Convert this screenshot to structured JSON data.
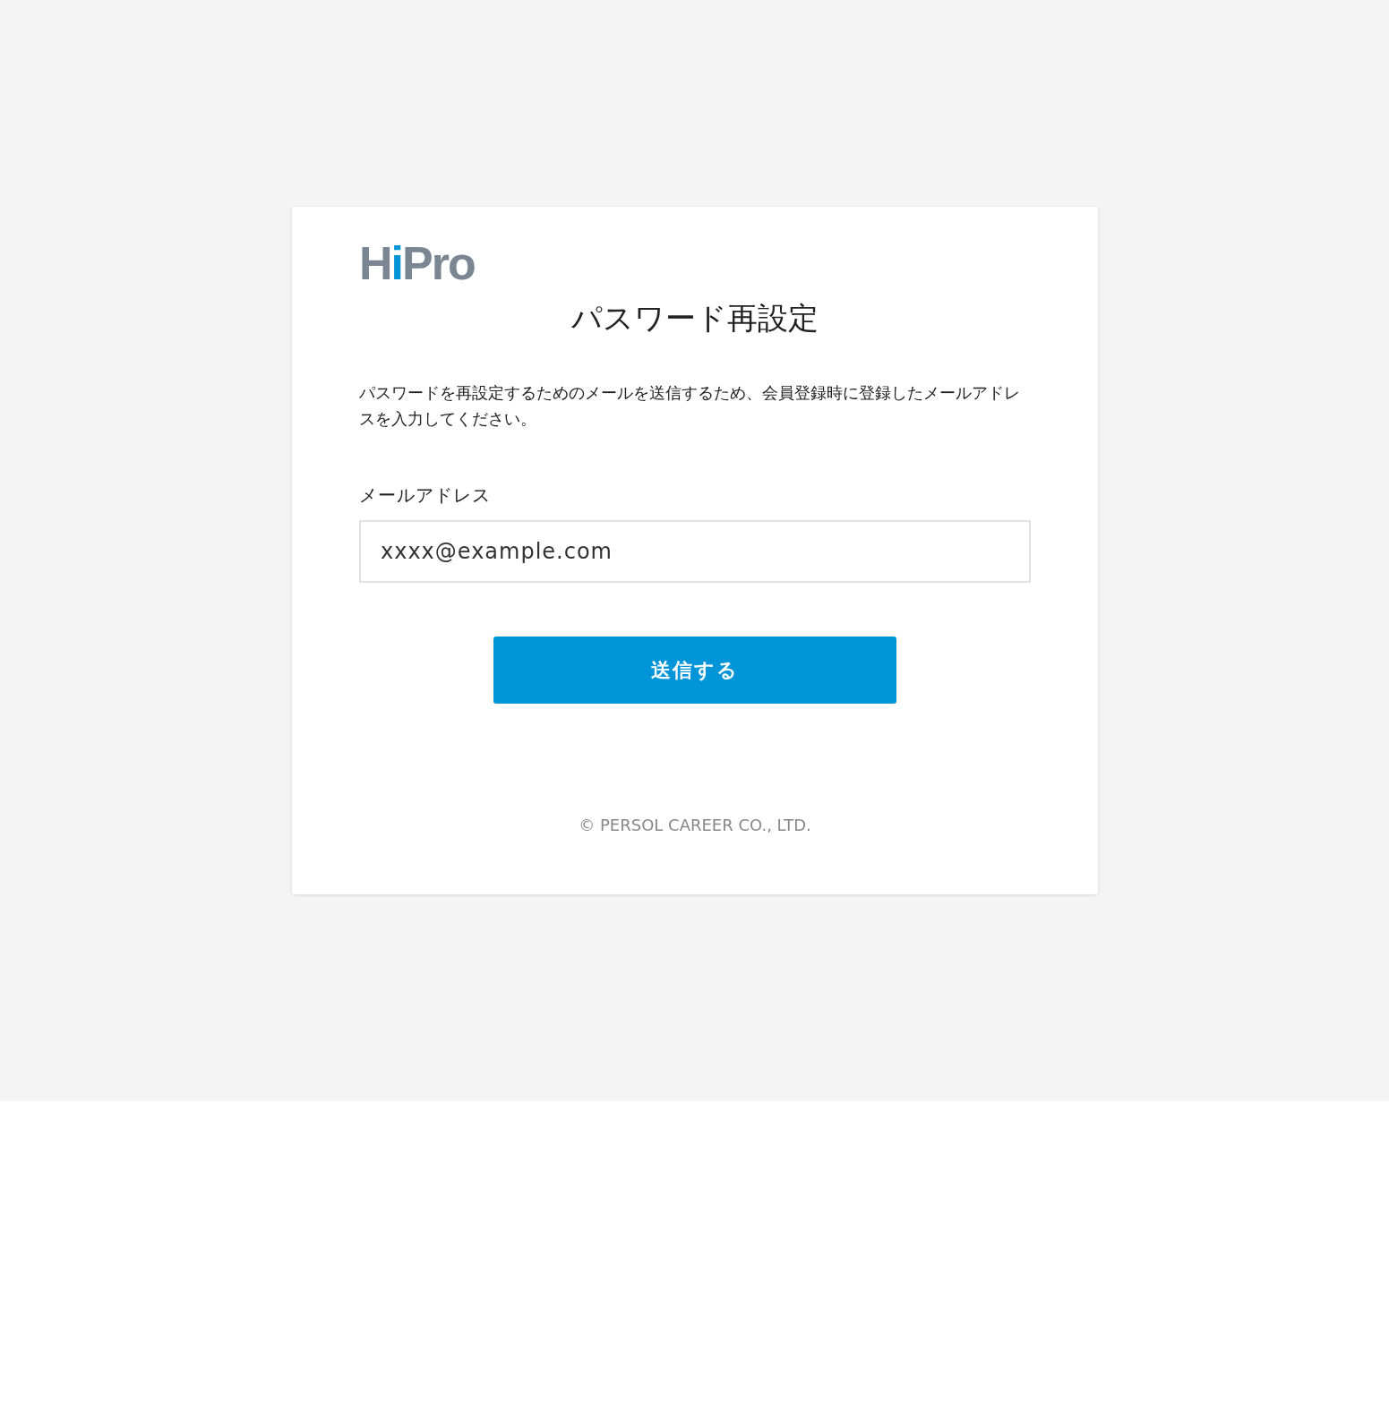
{
  "logo": {
    "parts": [
      {
        "text": "H",
        "color": "#7a8792"
      },
      {
        "text": "i",
        "color": "#0095d9"
      },
      {
        "text": "Pro",
        "color": "#7a8792"
      }
    ]
  },
  "title": "パスワード再設定",
  "description": "パスワードを再設定するためのメールを送信するため、会員登録時に登録したメールアドレスを入力してください。",
  "email_field": {
    "label": "メールアドレス",
    "placeholder": "xxxx@example.com"
  },
  "submit_button": "送信する",
  "footer": "© PERSOL CAREER CO., LTD."
}
